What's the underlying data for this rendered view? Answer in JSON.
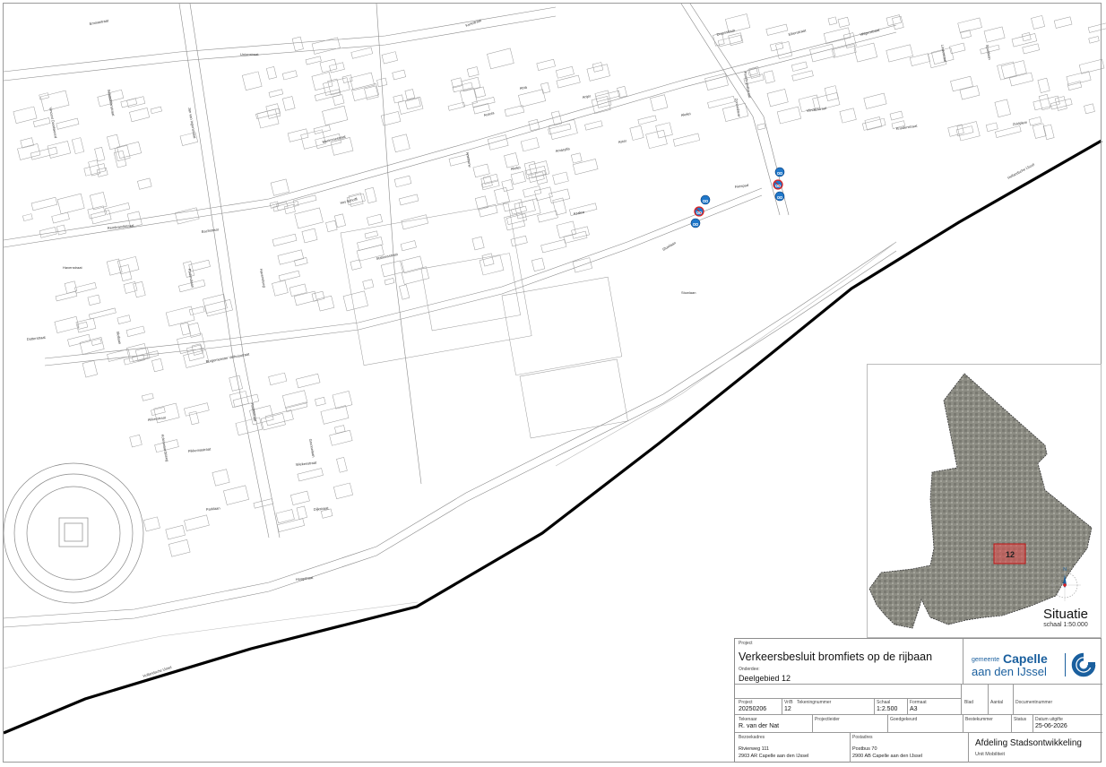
{
  "map": {
    "street_labels": [
      "Emmastraat",
      "Sebastiaanstraat",
      "Unionstraat",
      "Jan van Ingenstraat",
      "Vincent Doodweerd",
      "Kerkstraat",
      "Bachstraat",
      "Merimmestraat",
      "Rembrandtstraat",
      "Havenstraat",
      "Het Schoffl",
      "Stationsstraat",
      "Havensteeg",
      "Radenalaan",
      "Dotterstraat",
      "Slotlaan",
      "Burgemeester Velhuisstraat",
      "Kolenwaardsteeg",
      "Akkerstraat",
      "Pikkemastraat",
      "Hoofdstraat",
      "Parklaan",
      "Wiekenstraat",
      "Grunnelaan",
      "Dijkstraat",
      "Hoogstraat",
      "Stuwlaan",
      "Stuwlaan",
      "Acacia",
      "Anemone",
      "Akelei",
      "Atria",
      "Amaryllis",
      "Azalea",
      "Anjer",
      "Aster",
      "Akelei",
      "Dorpsstraat",
      "Zonnedauw",
      "Eikenstraat",
      "Wilgenstraat",
      "Rembrandtstraat",
      "Vlinderstraat",
      "Kruidenstraat",
      "Lindestraat",
      "Sportlaan",
      "Zuidplein",
      "Fietspad",
      "Hollandsche IJssel",
      "Hollandsche IJssel"
    ],
    "traffic_signs": [
      "traffic-sign-mandatory-cycle",
      "traffic-sign-no-moped",
      "traffic-sign-mandatory-cycle",
      "traffic-sign-mandatory-cycle",
      "traffic-sign-no-moped",
      "traffic-sign-mandatory-cycle",
      "traffic-sign-no-moped"
    ]
  },
  "inset": {
    "area_label": "12",
    "title": "Situatie",
    "scale": "schaal 1:50.000",
    "north": "N"
  },
  "titleblock": {
    "project_label": "Project",
    "project": "Verkeersbesluit bromfiets op de rijbaan",
    "subject_label": "Onderdee:",
    "subject": "Deelgebied 12",
    "brand": {
      "line1_small": "gemeente",
      "line1_big": "Capelle",
      "line2": "aan den IJssel"
    },
    "fields": {
      "projectnr_label": "Project",
      "projectnr": "20250206",
      "vr_label": "Vr/B",
      "tekening_label": "Tekeningnummer",
      "tekening": "12",
      "schaal_label": "Schaal",
      "schaal": "1:2.500",
      "formaat_label": "Formaat",
      "formaat": "A3",
      "blad_label": "Blad",
      "aantal_label": "Aantal",
      "documentnr_label": "Documentnummer",
      "tekenaar_label": "Tekenaar",
      "tekenaar": "R. van der Nat",
      "projectleider_label": "Projectleider",
      "goedgekeurd_label": "Goedgekeurd",
      "bestek_label": "Bestekummer",
      "status_label": "Status",
      "datum_label": "Datum uitgifte",
      "datum": "25-06-2026",
      "bezoek_label": "Bezoekadres",
      "bezoek1": "Rivierweg 111",
      "bezoek2": "2903 AR Capelle aan den IJssel",
      "post_label": "Postadres",
      "post1": "Postbus 70",
      "post2": "2900 AB Capelle aan den IJssel",
      "afdeling": "Afdeling Stadsontwikkeling",
      "unit": "Unit Mobiliteit"
    }
  },
  "colors": {
    "river_line": "#000000",
    "map_line": "#8a8a8a",
    "aerial": "#8b8b82",
    "highlight": "#e04848",
    "brand_blue": "#1a5f9e",
    "sign_blue": "#1f77c9"
  }
}
